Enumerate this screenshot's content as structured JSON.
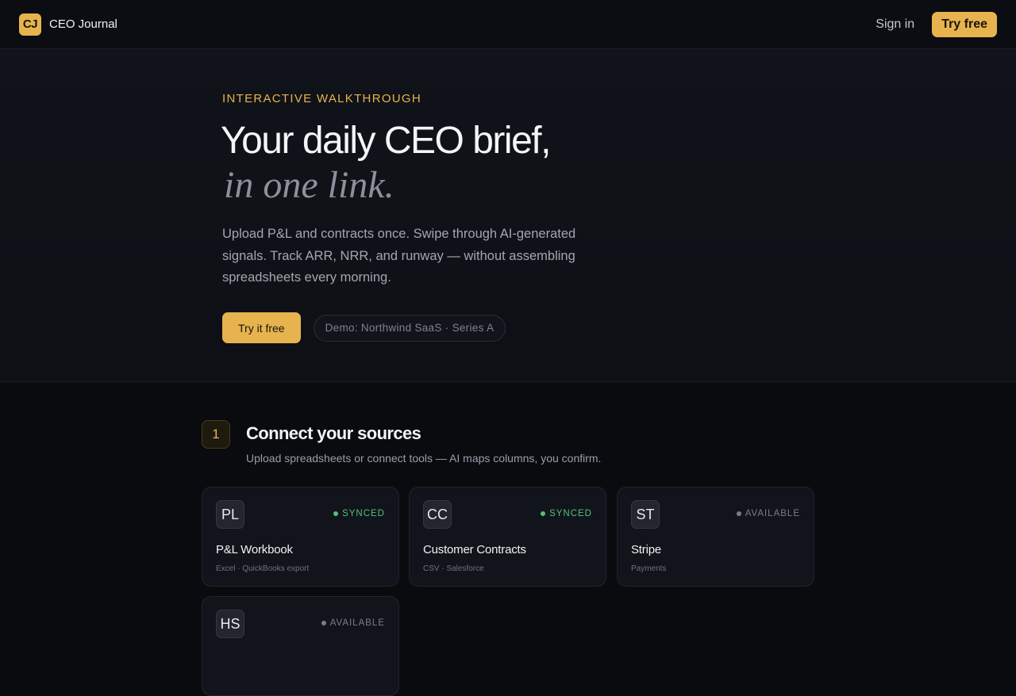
{
  "header": {
    "logo_text": "CJ",
    "brand_name": "CEO Journal",
    "signin_label": "Sign in",
    "try_label": "Try free"
  },
  "hero": {
    "eyebrow": "INTERACTIVE WALKTHROUGH",
    "headline": "Your daily CEO brief,",
    "headline_italic": "in one link.",
    "lede": "Upload P&L and contracts once. Swipe through AI-generated signals. Track ARR, NRR, and runway — without assembling spreadsheets every morning.",
    "cta_label": "Try it free",
    "demo_label": "Demo: Northwind SaaS · Series A"
  },
  "step": {
    "number": "1",
    "title": "Connect your sources",
    "subtitle": "Upload spreadsheets or connect tools — AI maps columns, you confirm."
  },
  "sources": [
    {
      "icon": "PL",
      "title": "P&L Workbook",
      "meta": "Excel · QuickBooks export",
      "status": "SYNCED"
    },
    {
      "icon": "CC",
      "title": "Customer Contracts",
      "meta": "CSV · Salesforce",
      "status": "SYNCED"
    },
    {
      "icon": "ST",
      "title": "Stripe",
      "meta": "Payments",
      "status": "AVAILABLE"
    },
    {
      "icon": "HS",
      "title": "",
      "meta": "",
      "status": "AVAILABLE"
    }
  ],
  "colors": {
    "accent": "#e6b34f",
    "synced": "#4fc27a",
    "available": "#7a7d89"
  }
}
